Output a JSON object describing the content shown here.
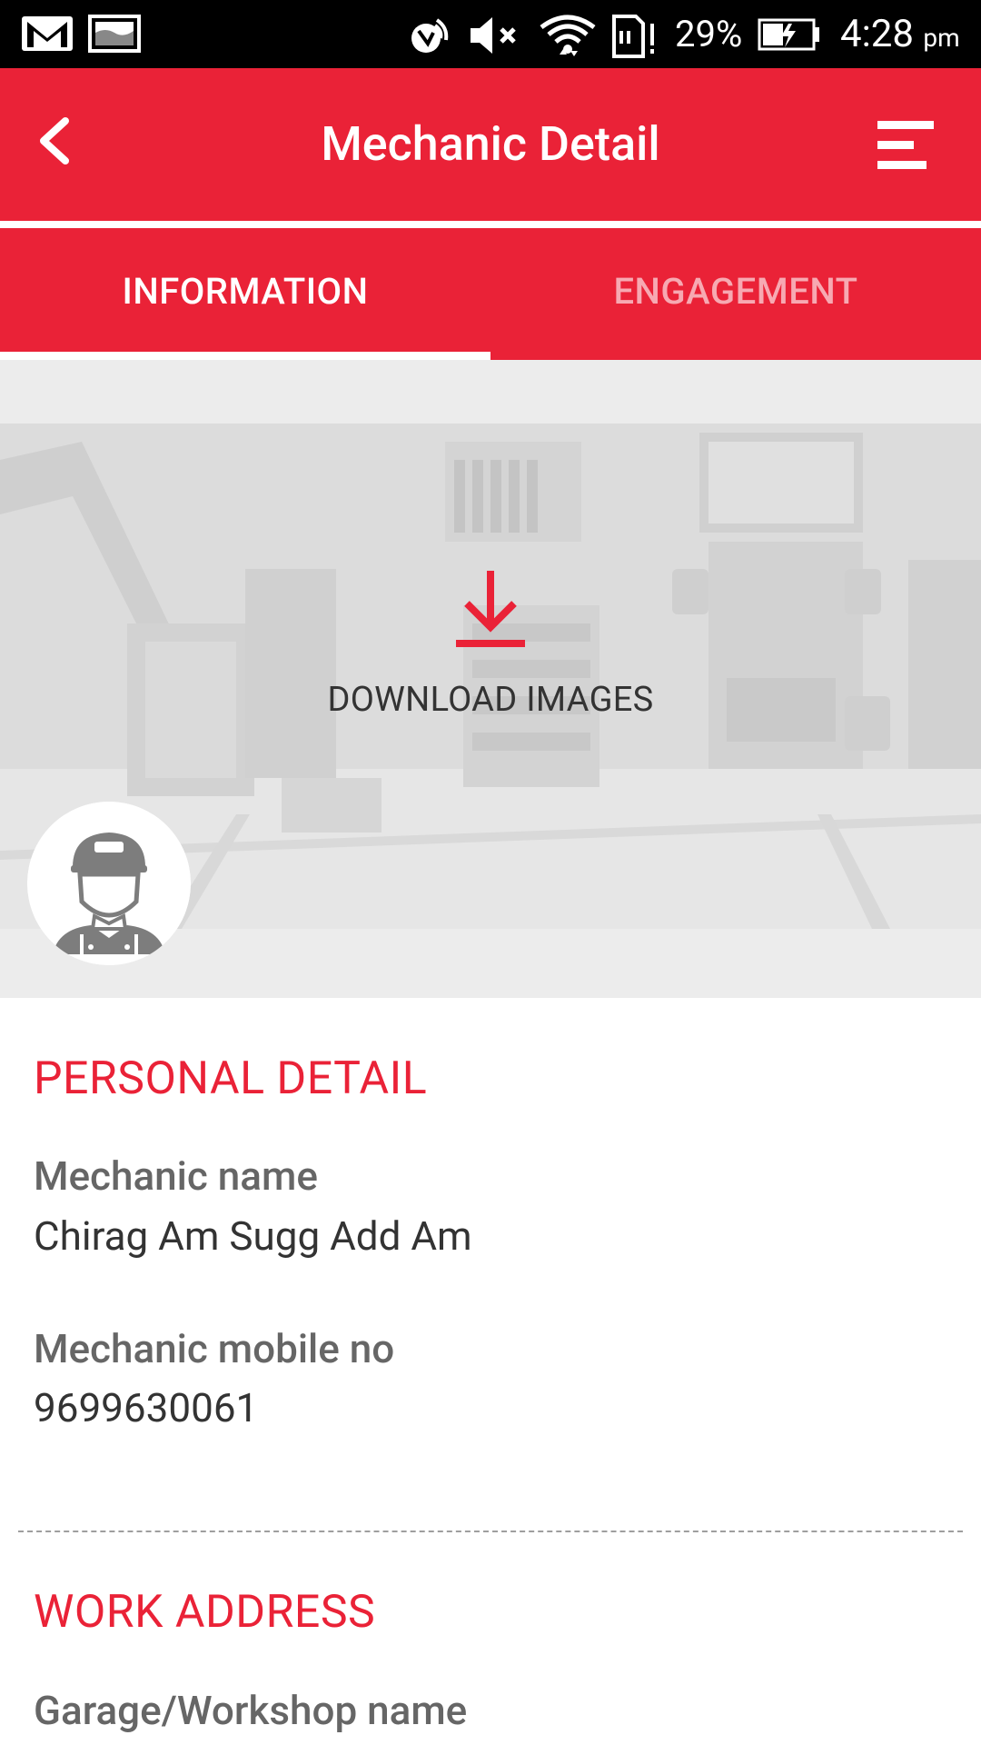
{
  "status_bar": {
    "battery": "29%",
    "time": "4:28",
    "time_suffix": "pm",
    "icons": [
      "gmail-icon",
      "gallery-icon",
      "nfc-icon",
      "mute-icon",
      "wifi-icon",
      "sd-card-alert-icon",
      "battery-charging-icon"
    ]
  },
  "app_bar": {
    "title": "Mechanic Detail",
    "back_icon": "chevron-left-icon",
    "menu_icon": "menu-icon"
  },
  "tabs": [
    {
      "label": "INFORMATION",
      "active": true
    },
    {
      "label": "ENGAGEMENT",
      "active": false
    }
  ],
  "banner": {
    "download_label": "DOWNLOAD IMAGES",
    "download_icon": "download-icon",
    "avatar_icon": "mechanic-avatar-icon"
  },
  "personal_detail": {
    "title": "PERSONAL DETAIL",
    "fields": [
      {
        "label": "Mechanic name",
        "value": "Chirag Am Sugg Add Am"
      },
      {
        "label": "Mechanic mobile no",
        "value": "9699630061"
      }
    ]
  },
  "work_address": {
    "title": "WORK ADDRESS",
    "fields": [
      {
        "label": "Garage/Workshop name"
      }
    ]
  },
  "colors": {
    "brand_red": "#ea2237",
    "tab_inactive": "#f7a9b2",
    "label_gray": "#666666",
    "value_dark": "#333333"
  }
}
